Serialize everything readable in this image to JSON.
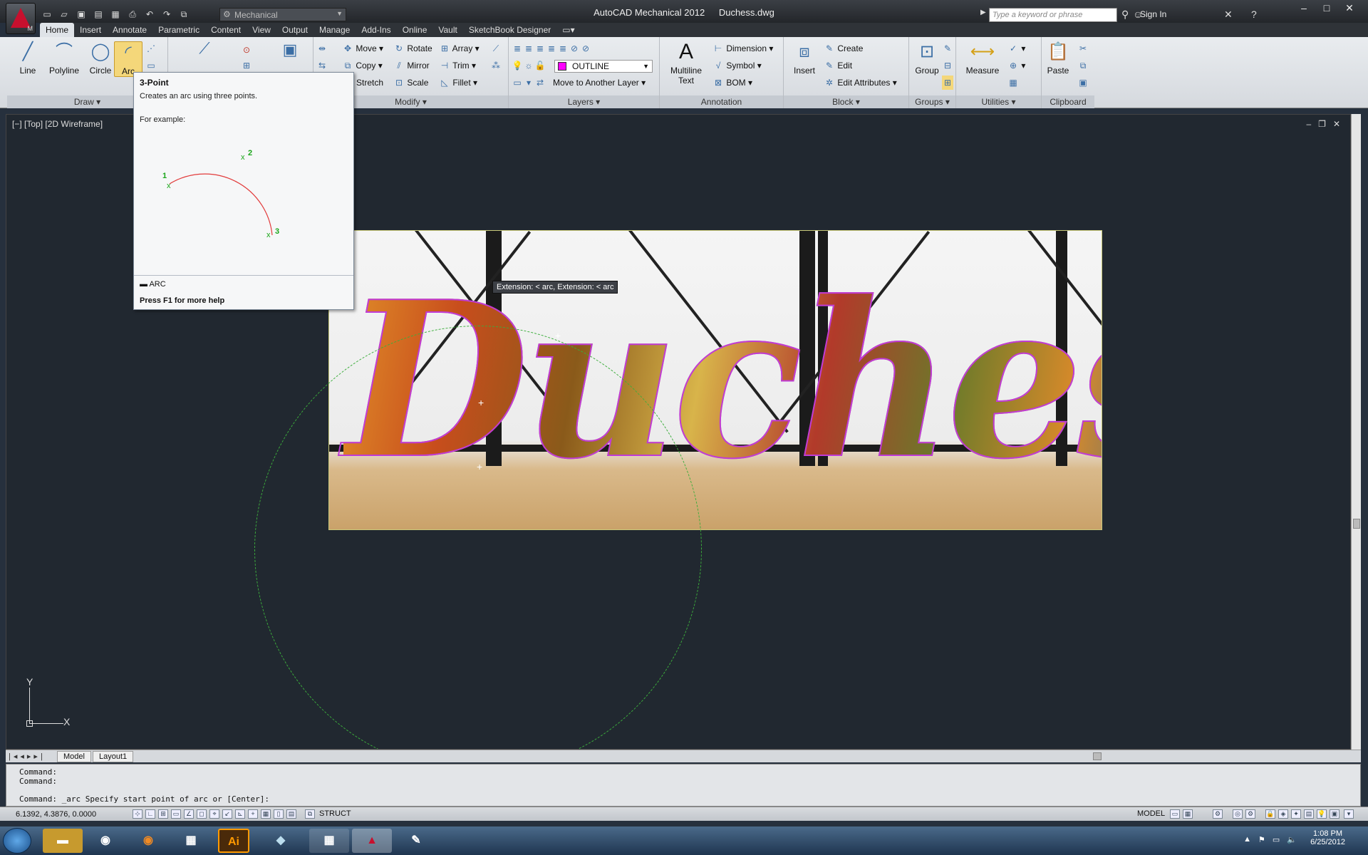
{
  "titlebar": {
    "workspace": "Mechanical",
    "app_title": "AutoCAD Mechanical 2012",
    "file_name": "Duchess.dwg",
    "search_placeholder": "Type a keyword or phrase",
    "sign_in": "Sign In"
  },
  "ribbon_tabs": [
    "Home",
    "Insert",
    "Annotate",
    "Parametric",
    "Content",
    "View",
    "Output",
    "Manage",
    "Add-Ins",
    "Online",
    "Vault",
    "SketchBook Designer"
  ],
  "draw": {
    "title": "Draw",
    "line": "Line",
    "polyline": "Polyline",
    "circle": "Circle",
    "arc": "Arc"
  },
  "modify": {
    "title": "Modify",
    "move": "Move",
    "rotate": "Rotate",
    "array": "Array",
    "copy": "Copy",
    "mirror": "Mirror",
    "trim": "Trim",
    "stretch": "Stretch",
    "scale": "Scale",
    "fillet": "Fillet"
  },
  "layers": {
    "title": "Layers",
    "current_layer": "OUTLINE",
    "layer_color": "#ff00ff",
    "move_to_layer": "Move to Another Layer"
  },
  "annotation": {
    "title": "Annotation",
    "multiline_text": "Multiline",
    "multiline_text2": "Text",
    "dimension": "Dimension",
    "symbol": "Symbol",
    "bom": "BOM"
  },
  "block": {
    "title": "Block",
    "insert": "Insert",
    "create": "Create",
    "edit": "Edit",
    "edit_attributes": "Edit Attributes"
  },
  "groups": {
    "title": "Groups",
    "group": "Group"
  },
  "utilities": {
    "title": "Utilities",
    "measure": "Measure"
  },
  "clipboard": {
    "title": "Clipboard",
    "paste": "Paste"
  },
  "tooltip": {
    "title": "3-Point",
    "description": "Creates an arc using three points.",
    "example": "For example:",
    "pt1": "1",
    "pt2": "2",
    "pt3": "3",
    "command": "ARC",
    "help": "Press F1 for more help"
  },
  "viewport": {
    "label": "[−] [Top] [2D Wireframe]",
    "extension_tip": "Extension: < arc,  Extension: < arc",
    "photo_word": "Duchess",
    "ucs_x": "X",
    "ucs_y": "Y"
  },
  "layout_tabs": {
    "model": "Model",
    "layout1": "Layout1"
  },
  "command_line": {
    "line1": "Command:",
    "line2": "Command:",
    "prompt": "Command: _arc Specify start point of arc or [Center]:"
  },
  "statusbar": {
    "coords": "6.1392, 4.3876, 0.0000",
    "struct": "STRUCT",
    "model": "MODEL"
  },
  "taskbar": {
    "time": "1:08 PM",
    "date": "6/25/2012",
    "ai_label": "Ai"
  }
}
